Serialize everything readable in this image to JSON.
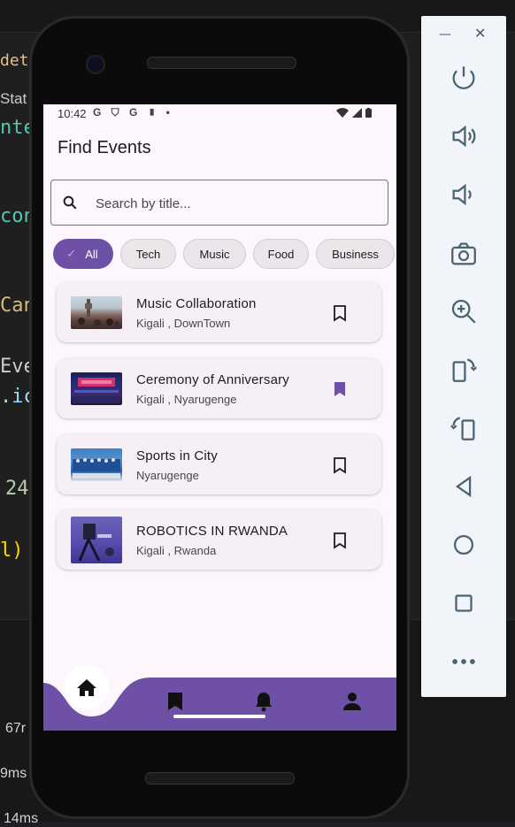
{
  "background": {
    "editor_fragments": [
      "det",
      "Stat",
      "nte",
      "con",
      "Can",
      "Eve",
      ".ic",
      "24",
      "l)"
    ],
    "terminal_fragments": [
      "67r",
      "9ms",
      "14ms"
    ]
  },
  "emulator_toolbar": {
    "minimize": "—",
    "close": "✕",
    "tools": [
      {
        "icon": "power-icon"
      },
      {
        "icon": "volume-up-icon"
      },
      {
        "icon": "volume-down-icon"
      },
      {
        "icon": "camera-icon"
      },
      {
        "icon": "zoom-icon"
      },
      {
        "icon": "rotate-left-icon"
      },
      {
        "icon": "rotate-right-icon"
      },
      {
        "icon": "back-icon"
      },
      {
        "icon": "home-icon"
      },
      {
        "icon": "overview-icon"
      },
      {
        "icon": "more-icon"
      }
    ]
  },
  "status_bar": {
    "time": "10:42",
    "left_icons": "G ⛉ G ▮ •"
  },
  "app": {
    "title": "Find Events",
    "search": {
      "placeholder": "Search by title..."
    },
    "chips": [
      {
        "label": "All",
        "selected": true
      },
      {
        "label": "Tech",
        "selected": false
      },
      {
        "label": "Music",
        "selected": false
      },
      {
        "label": "Food",
        "selected": false
      },
      {
        "label": "Business",
        "selected": false
      }
    ],
    "events": [
      {
        "title": "Music Collaboration",
        "location": "Kigali , DownTown",
        "bookmarked": false
      },
      {
        "title": "Ceremony of Anniversary",
        "location": "Kigali , Nyarugenge",
        "bookmarked": true
      },
      {
        "title": "Sports in City",
        "location": "Nyarugenge",
        "bookmarked": false
      },
      {
        "title": "ROBOTICS IN RWANDA",
        "location": "Kigali , Rwanda",
        "bookmarked": false
      }
    ],
    "bottom_nav": [
      "home-icon",
      "bookmark-icon",
      "bell-icon",
      "person-icon"
    ],
    "colors": {
      "accent": "#6e51a6",
      "screen_bg": "#fdf6fd",
      "card_bg": "#f6eff5"
    }
  }
}
